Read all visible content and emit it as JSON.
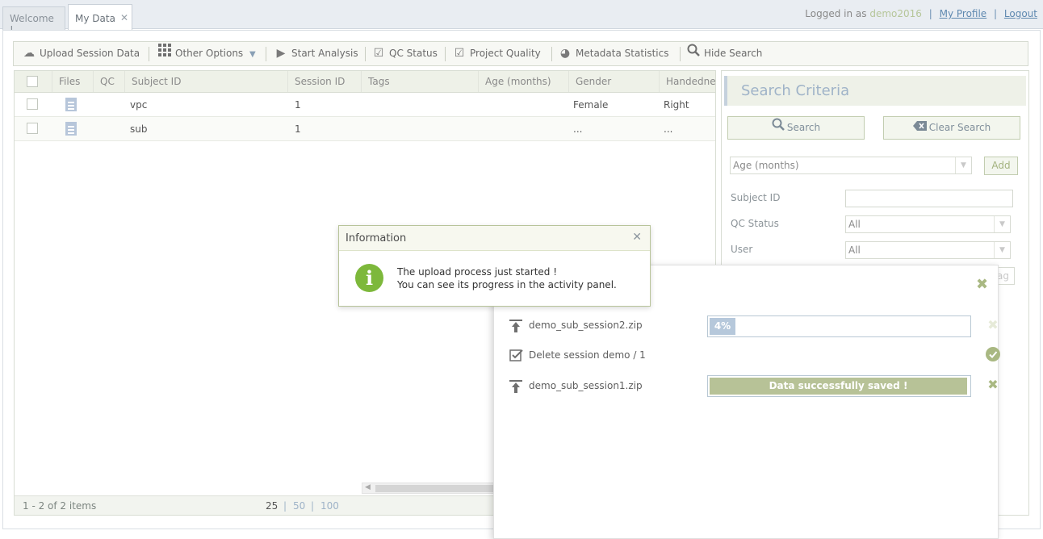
{
  "tabs": [
    {
      "label": "Welcome !"
    },
    {
      "label": "My Data",
      "close": "✕"
    }
  ],
  "user": {
    "logged_label": "Logged in as",
    "username": "demo2016",
    "separator": "|",
    "profile_link": "My Profile",
    "logout_link": "Logout"
  },
  "toolbar": {
    "upload": "Upload Session Data",
    "other": "Other Options",
    "start": "Start Analysis",
    "qc": "QC Status",
    "project_quality": "Project Quality",
    "metadata": "Metadata Statistics",
    "hide_search": "Hide Search"
  },
  "grid": {
    "columns": [
      "Files",
      "QC",
      "Subject ID",
      "Session ID",
      "Tags",
      "Age (months)",
      "Gender",
      "Handedne"
    ],
    "rows": [
      {
        "subject": "vpc",
        "session": "1",
        "tags": "",
        "age": "",
        "gender": "Female",
        "handedness": "Right"
      },
      {
        "subject": "sub",
        "session": "1",
        "tags": "",
        "age": "",
        "gender": "...",
        "handedness": "..."
      }
    ],
    "footer": {
      "range": "1 - 2 of 2 items",
      "page_sizes": [
        "25",
        "50",
        "100"
      ],
      "sep": "|"
    }
  },
  "search": {
    "title": "Search Criteria",
    "search_button": "Search",
    "clear_button": "Clear Search",
    "field_select": "Age (months)",
    "add_button": "Add",
    "subject_label": "Subject ID",
    "subject_value": "",
    "qc_label": "QC Status",
    "qc_value": "All",
    "user_label": "User",
    "user_value": "All",
    "partial_text": "ag"
  },
  "activity": {
    "close": "✖",
    "items": [
      {
        "name": "demo_sub_session2.zip",
        "progress_text": "4%",
        "progress": 0.1,
        "status": "✖"
      },
      {
        "name": "Delete session demo / 1",
        "status": "✔"
      },
      {
        "name": "demo_sub_session1.zip",
        "progress_text": "Data successfully saved !",
        "progress": 1.0,
        "status": "✖"
      }
    ]
  },
  "dialog": {
    "title": "Information",
    "close": "✕",
    "line1": "The upload process just started !",
    "line2": "You can see its progress in the activity panel."
  },
  "colors": {
    "accent_green": "#7db83b",
    "progress_blue": "#b6c8db",
    "progress_green": "#b7c297",
    "done_green": "#a9b882"
  }
}
